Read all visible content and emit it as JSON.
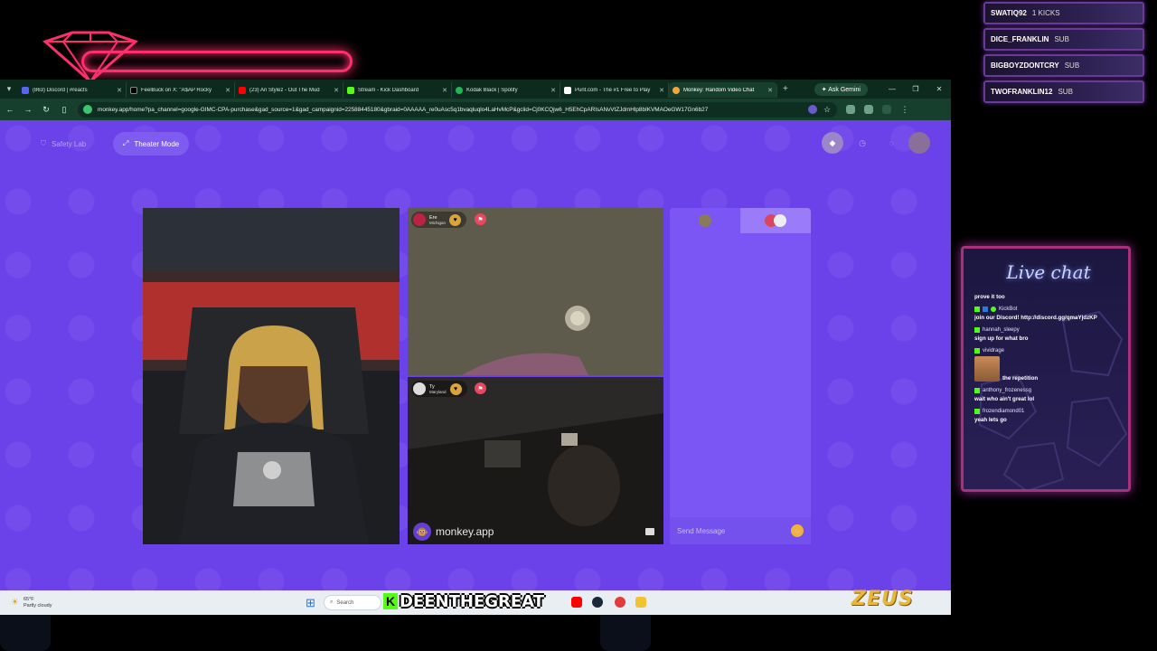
{
  "alerts": [
    {
      "user": "SWATIQ92",
      "type": "1 KICKS"
    },
    {
      "user": "DICE_FRANKLIN",
      "type": "SUB"
    },
    {
      "user": "BIGBOYZDONTCRY",
      "type": "SUB"
    },
    {
      "user": "TWOFRANKLIN12",
      "type": "SUB"
    }
  ],
  "browser": {
    "tabs": [
      {
        "label": "(863) Discord | #reacts",
        "color": "#5865f2",
        "active": false
      },
      {
        "label": "FeelBuck on X: \"A$AP Rocky",
        "color": "#000000",
        "active": false
      },
      {
        "label": "(23) Ari Stylez - Out The Mud",
        "color": "#ff0000",
        "active": false
      },
      {
        "label": "Stream - Kick Dashboard",
        "color": "#53fc18",
        "active": false
      },
      {
        "label": "Kodak Black | Spotify",
        "color": "#1db954",
        "active": false
      },
      {
        "label": "Punt.com - The #1 Free to Play",
        "color": "#ffffff",
        "active": false
      },
      {
        "label": "Monkey: Random Video Chat",
        "color": "#f4a53a",
        "active": true
      }
    ],
    "gemini_label": "Ask Gemini",
    "url": "monkey.app/home?pa_channel=google-GIMC-CPA-purchase&gad_source=1&gad_campaignid=22588445180&gbraid=0AAAAA_re0uAsc5q1bvaqluqlo4LaHvMcP&gclid=Cj0KCQjw6_H5EhCpARIsANvVtZJdmHlp8bIKVMAOeGW17Gn6b27"
  },
  "page": {
    "safety_label": "Safety Lab",
    "theater_label": "Theater Mode",
    "remote_user_1": {
      "name": "Ere",
      "location": "Michigan"
    },
    "remote_user_2": {
      "name": "Ty",
      "location": "Maryland"
    },
    "watermark": "monkey.app",
    "send_placeholder": "Send Message"
  },
  "taskbar": {
    "temperature": "65°F",
    "condition": "Partly cloudy",
    "search_label": "Search"
  },
  "overlay": {
    "k_badge": "K",
    "streamer_name": "DEENTHEGREAT",
    "brand_logo": "ZEUS"
  },
  "livechat": {
    "title": "Live chat",
    "messages": [
      {
        "user": "",
        "text": "prove it too"
      },
      {
        "user": "KickBot",
        "text": "join our Discord! http://discord.gg/qmaYjdzKP"
      },
      {
        "user": "hannah_sleepy",
        "text": "sign up for what bro"
      },
      {
        "user": "vividrage",
        "text": "the repetition",
        "emote": true
      },
      {
        "user": "anthony_frozenessg",
        "text": "wait who ain't great lol"
      },
      {
        "user": "frozendiamond01",
        "text": "yeah lets go"
      }
    ]
  },
  "colors": {
    "page_bg": "#6b42ea",
    "kick_green": "#53fc18",
    "browser_green": "#173f2e",
    "overlay_pink": "#ff2f6e"
  }
}
